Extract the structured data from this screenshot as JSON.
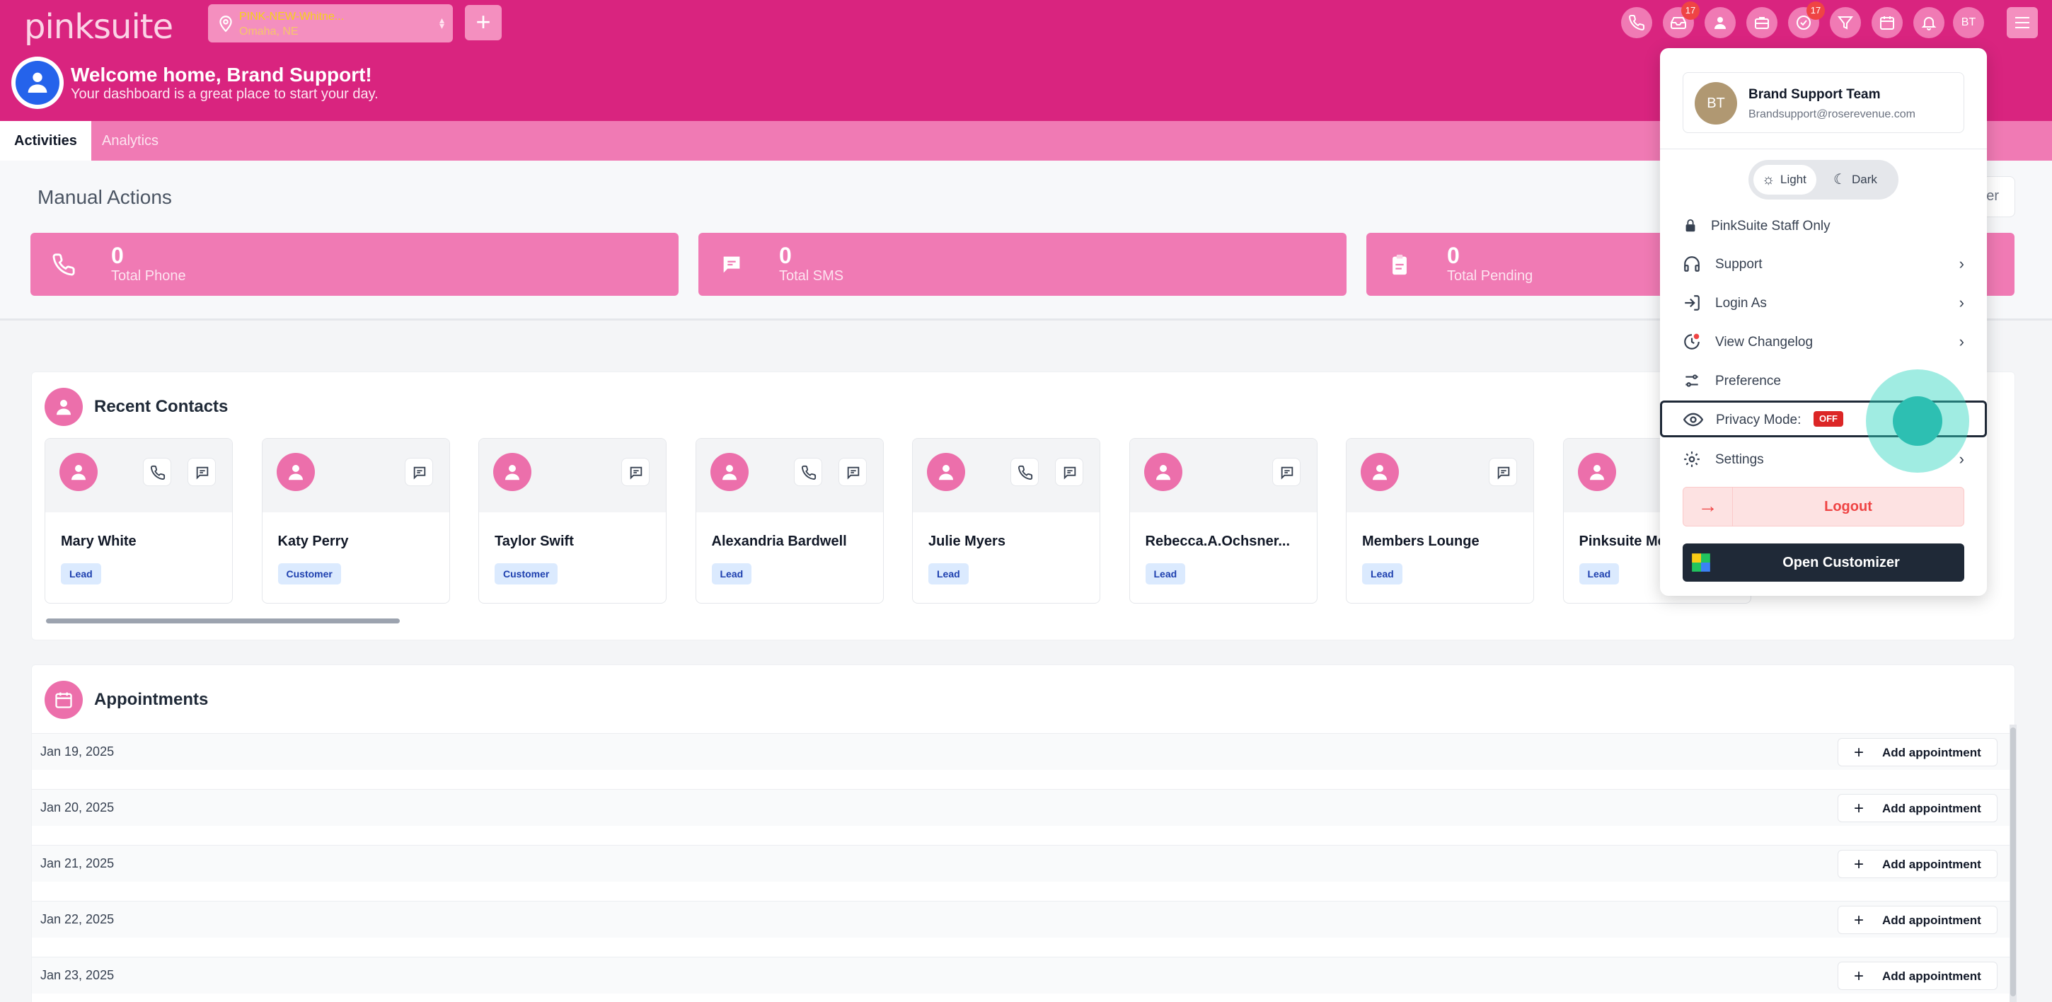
{
  "topbar": {
    "logo": "pinksuite",
    "location": {
      "line1": "PINK-NEW-Whitne...",
      "line2": "Omaha, NE"
    },
    "plus_label": "+",
    "badge_inbox": "17",
    "badge_tasks": "17",
    "avatar_initials": "BT"
  },
  "welcome": {
    "title": "Welcome home, Brand Support!",
    "subtitle": "Your dashboard is a great place to start your day."
  },
  "tabs": [
    {
      "label": "Activities"
    },
    {
      "label": "Analytics"
    }
  ],
  "manual": {
    "title": "Manual Actions",
    "filter_label": "er",
    "stats": [
      {
        "value": "0",
        "label": "Total Phone",
        "icon": "phone-icon"
      },
      {
        "value": "0",
        "label": "Total SMS",
        "icon": "message-icon"
      },
      {
        "value": "0",
        "label": "Total Pending",
        "icon": "clipboard-icon"
      }
    ]
  },
  "recent": {
    "title": "Recent Contacts",
    "contacts": [
      {
        "name": "Mary White",
        "tag": "Lead",
        "phone": true
      },
      {
        "name": "Katy Perry",
        "tag": "Customer",
        "phone": false
      },
      {
        "name": "Taylor Swift",
        "tag": "Customer",
        "phone": false
      },
      {
        "name": "Alexandria Bardwell",
        "tag": "Lead",
        "phone": true
      },
      {
        "name": "Julie Myers",
        "tag": "Lead",
        "phone": true
      },
      {
        "name": "Rebecca.A.Ochsner...",
        "tag": "Lead",
        "phone": false
      },
      {
        "name": "Members Lounge",
        "tag": "Lead",
        "phone": false
      },
      {
        "name": "Pinksuite Me",
        "tag": "Lead",
        "phone": false
      }
    ]
  },
  "appointments": {
    "title": "Appointments",
    "add_label": "Add appointment",
    "rows": [
      {
        "date": "Jan 19, 2025"
      },
      {
        "date": "Jan 20, 2025"
      },
      {
        "date": "Jan 21, 2025"
      },
      {
        "date": "Jan 22, 2025"
      },
      {
        "date": "Jan 23, 2025"
      }
    ]
  },
  "dropdown": {
    "initials": "BT",
    "name": "Brand Support Team",
    "email": "Brandsupport@roserevenue.com",
    "theme_light": "Light",
    "theme_dark": "Dark",
    "staff_only": "PinkSuite Staff Only",
    "support": "Support",
    "login_as": "Login As",
    "changelog": "View Changelog",
    "preference": "Preference",
    "privacy_mode": "Privacy Mode:",
    "privacy_state": "OFF",
    "settings": "Settings",
    "logout": "Logout",
    "open_customizer": "Open Customizer"
  },
  "colors": {
    "brand": "#d9247f",
    "brand_light": "#f07ab4",
    "danger": "#ef4444",
    "cursor": "#2dbfb2"
  }
}
